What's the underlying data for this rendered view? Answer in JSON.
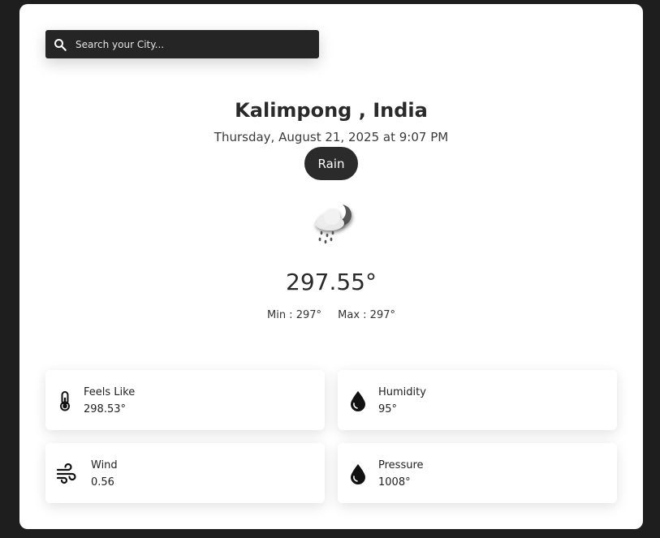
{
  "search": {
    "placeholder": "Search your City..."
  },
  "weather": {
    "city": "Kalimpong , India",
    "datetime": "Thursday, August 21, 2025 at 9:07 PM",
    "condition": "Rain",
    "icon": "rain-cloud-night-icon",
    "temperature": "297.55°",
    "min": "Min : 297°",
    "max": "Max : 297°"
  },
  "details": {
    "feels_like": {
      "label": "Feels Like",
      "value": "298.53°",
      "icon": "thermometer-icon"
    },
    "humidity": {
      "label": "Humidity",
      "value": "95°",
      "icon": "water-drop-icon"
    },
    "wind": {
      "label": "Wind",
      "value": "0.56",
      "icon": "wind-icon"
    },
    "pressure": {
      "label": "Pressure",
      "value": "1008°",
      "icon": "water-drop-icon"
    }
  },
  "colors": {
    "page_background": "#1e1e1e",
    "card_background": "#ffffff",
    "search_background": "#252525",
    "condition_badge": "#2b2b2b"
  }
}
